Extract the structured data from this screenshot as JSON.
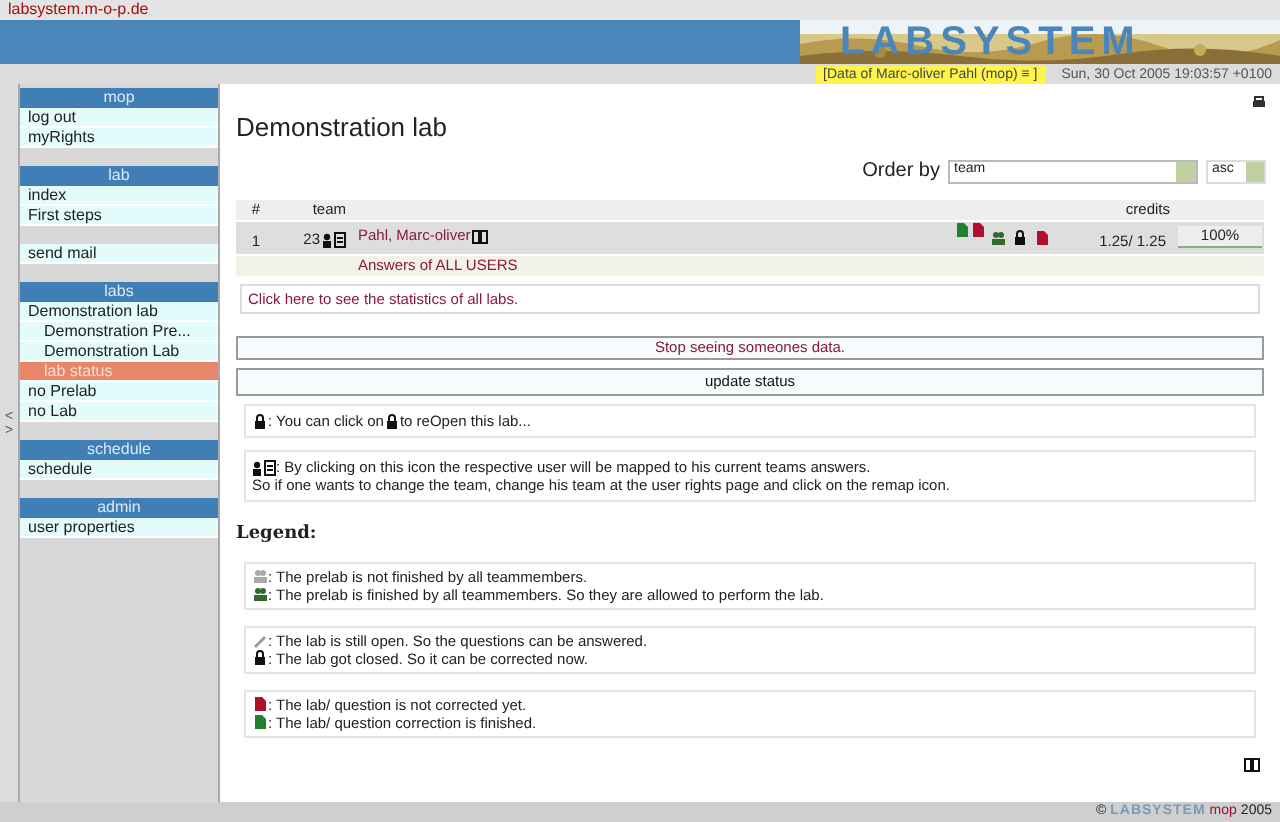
{
  "site": {
    "address": "labsystem.m-o-p.de",
    "logo": "LABSYSTEM",
    "viewing": "[Data of Marc-oliver Pahl (mop) ≡ ]",
    "date": "Sun, 30 Oct 2005 19:03:57 +0100"
  },
  "collapse_toggles": [
    "<",
    ">"
  ],
  "sidebar": [
    {
      "header": "mop",
      "items": [
        {
          "label": "log out",
          "selected": false
        },
        {
          "label": "myRights",
          "selected": false
        }
      ]
    },
    {
      "header": "lab",
      "items": [
        {
          "label": "index",
          "selected": false
        },
        {
          "label": "First steps",
          "selected": false
        }
      ]
    },
    {
      "items": [
        {
          "label": "send mail",
          "selected": false
        }
      ]
    },
    {
      "header": "labs",
      "items": [
        {
          "label": "Demonstration lab",
          "selected": false,
          "children": [
            {
              "label": "Demonstration Pre...",
              "selected": false
            },
            {
              "label": "Demonstration Lab",
              "selected": false
            },
            {
              "label": "lab status",
              "selected": true
            }
          ]
        },
        {
          "label": "no Prelab",
          "selected": false
        },
        {
          "label": "no Lab",
          "selected": false
        }
      ]
    },
    {
      "header": "schedule",
      "items": [
        {
          "label": "schedule",
          "selected": false
        }
      ]
    },
    {
      "header": "admin",
      "items": [
        {
          "label": "user properties",
          "selected": false
        }
      ]
    }
  ],
  "page": {
    "title": "Demonstration lab",
    "order_by": {
      "label": "Order by",
      "field": "team",
      "direction": "asc"
    },
    "table": {
      "columns": [
        "#",
        "team",
        "credits"
      ],
      "rows": [
        {
          "number": "1",
          "team": "23",
          "name": "Pahl, Marc-oliver",
          "credits": "1.25/ 1.25",
          "progress": "100%",
          "level": 1
        }
      ],
      "footer_link": "Answers of ALL USERS"
    },
    "statistics_link": "Click here to see the statistics of all labs.",
    "buttons": [
      "Stop seeing someones data.",
      "update status"
    ],
    "notes": [
      {
        "lines": [
          {
            "kind": "lock-click",
            "text": ": You can click on ",
            "after": " to reOpen this lab..."
          }
        ]
      },
      {
        "lines": [
          {
            "kind": "remap",
            "text": ": By clicking on this icon the respective user will be mapped to his current teams answers."
          },
          {
            "text": "So if one wants to change the team, change his team at the user rights page and click on the remap icon."
          }
        ]
      }
    ],
    "legend": {
      "title": "Legend:",
      "groups": [
        [
          {
            "kind": "team-gray",
            "text": ": The prelab is not finished by all teammembers."
          },
          {
            "kind": "team-green",
            "text": ": The prelab is finished by all teammembers. So they are allowed to perform the lab."
          }
        ],
        [
          {
            "kind": "pen",
            "text": ": The lab is still open. So the questions can be answered."
          },
          {
            "kind": "lock",
            "text": ": The lab got closed. So it can be corrected now."
          }
        ],
        [
          {
            "kind": "doc-red",
            "text": ": The lab/ question is not corrected yet."
          },
          {
            "kind": "doc-green",
            "text": ": The lab/ question correction is finished."
          }
        ]
      ]
    }
  },
  "footer": {
    "copyright": "©",
    "logo": "LABSYSTEM",
    "user": "mop",
    "year": "2005"
  }
}
